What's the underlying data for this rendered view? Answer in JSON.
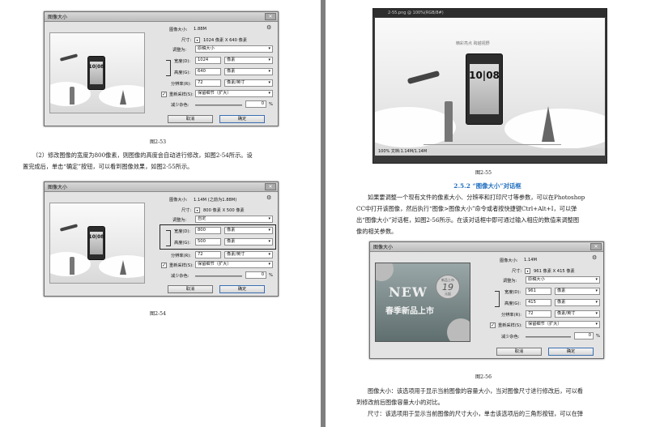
{
  "left_page": {
    "dialog1": {
      "title": "图像大小",
      "size_label": "图像大小:",
      "size_value": "1.88M",
      "dims_label": "尺寸:",
      "dims_value": "1024 像素 X 640 像素",
      "fit_label": "调整为:",
      "fit_value": "原稿大小",
      "width_label": "宽度(D):",
      "width_value": "1024",
      "width_unit": "像素",
      "height_label": "高度(G):",
      "height_value": "640",
      "height_unit": "像素",
      "res_label": "分辨率(R):",
      "res_value": "72",
      "res_unit": "像素/英寸",
      "resample_label": "重新采样(S):",
      "resample_value": "保留细节（扩大）",
      "noise_label": "减少杂色:",
      "noise_value": "0",
      "noise_unit": "%",
      "cancel": "取消",
      "ok": "确定",
      "thumb_clock": "10|08"
    },
    "caption1": "图2-53",
    "paragraph1_line1": "（2）修改图像的宽度为800像素，则图像的高度会自动进行修改，如图2-54所示。设",
    "paragraph1_line2": "置完成后，单击“确定”按钮，可以看到图像效果，如图2-55所示。",
    "dialog2": {
      "title": "图像大小",
      "size_label": "图像大小:",
      "size_value": "1.14M (之前为1.88M)",
      "dims_label": "尺寸:",
      "dims_value": "800 像素 X 500 像素",
      "fit_label": "调整为:",
      "fit_value": "自定",
      "width_label": "宽度(D):",
      "width_value": "800",
      "width_unit": "像素",
      "height_label": "高度(G):",
      "height_value": "500",
      "height_unit": "像素",
      "res_label": "分辨率(R):",
      "res_value": "72",
      "res_unit": "像素/英寸",
      "resample_label": "重新采样(S):",
      "resample_value": "保留细节（扩大）",
      "noise_label": "减少杂色:",
      "noise_value": "0",
      "noise_unit": "%",
      "cancel": "取消",
      "ok": "确定",
      "thumb_clock": "10|08"
    },
    "caption2": "图2-54"
  },
  "right_page": {
    "ps_window": {
      "title": "2-55.png @ 100%(RGB/8#)",
      "clock": "10|08",
      "headline": "精彩亮点 跨越视野",
      "status": "100%    文档:1.14M/1.14M"
    },
    "caption3": "图2-55",
    "section_title": "2.5.2 “图像大小”对话框",
    "paragraph2_line1": "如果要调整一个现有文件的像素大小、分辨率和打印尺寸等参数，可以在Photoshop",
    "paragraph2_line2": "CC中打开该图像，然后执行“图像>图像大小”命令或者按快捷键Ctrl+Alt+I，可以弹",
    "paragraph2_line3": "出“图像大小”对话框，如图2-56所示。在该对话框中即可通过输入相应的数值来调整图",
    "paragraph2_line4": "像的相关参数。",
    "dialog3": {
      "title": "图像大小",
      "size_label": "图像大小:",
      "size_value": "1.14M",
      "dims_label": "尺寸:",
      "dims_value": "961 像素 X 415 像素",
      "fit_label": "调整为:",
      "fit_value": "原稿大小",
      "width_label": "宽度(D):",
      "width_value": "961",
      "width_unit": "像素",
      "height_label": "高度(G):",
      "height_value": "415",
      "height_unit": "像素",
      "res_label": "分辨率(R):",
      "res_value": "72",
      "res_unit": "像素/英寸",
      "resample_label": "重新采样(S):",
      "resample_value": "保留细节（扩大）",
      "noise_label": "减少杂色:",
      "noise_value": "0",
      "noise_unit": "%",
      "cancel": "取消",
      "ok": "确定",
      "thumb_new": "NEW",
      "thumb_spring": "春季新品上市",
      "thumb_badge": "19",
      "thumb_badge_top": "新品上市",
      "thumb_badge_bottom": "元起"
    },
    "caption4": "图2-56",
    "paragraph3_line1": "图像大小：该选项用于显示当前图像的容量大小，当对图像尺寸进行修改后，可以看",
    "paragraph3_line2": "到修改前后图像容量大小的对比。",
    "paragraph4_line1": "尺寸：该选项用于显示当前图像的尺寸大小，单击该选项后的三角形按钮，可以在弹"
  }
}
